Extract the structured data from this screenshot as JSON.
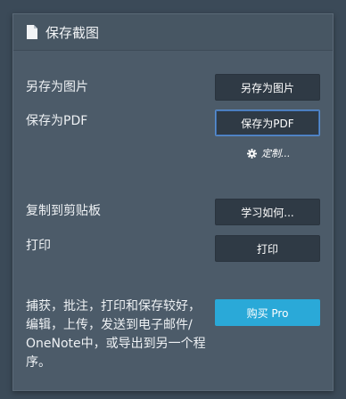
{
  "panel": {
    "title": "保存截图",
    "title_icon": "document-icon"
  },
  "save_image": {
    "label": "另存为图片",
    "button": "另存为图片"
  },
  "save_pdf": {
    "label": "保存为PDF",
    "button": "保存为PDF",
    "customize": "定制..."
  },
  "clipboard": {
    "label": "复制到剪贴板",
    "button": "学习如何..."
  },
  "print": {
    "label": "打印",
    "button": "打印"
  },
  "promo": {
    "text": "捕获，批注，打印和保存较好，编辑，上传，发送到电子邮件/ OneNote中，或导出到另一个程序。",
    "button": "购买 Pro"
  },
  "colors": {
    "background": "#3b4a58",
    "panel": "#4c5b69",
    "button": "#2f3a45",
    "pro_button": "#2aa9d8",
    "focus_border": "#5a8fd0"
  }
}
